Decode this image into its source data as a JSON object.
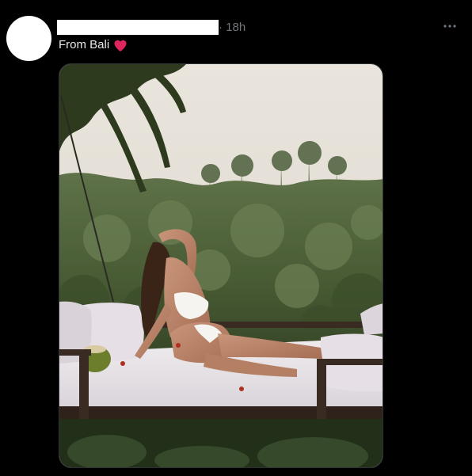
{
  "tweet": {
    "timestamp": "· 18h",
    "text": "From Bali",
    "emoji_icon": "heart-icon",
    "emoji_color": "#f91880",
    "more_icon": "more-horizontal-icon",
    "media": {
      "kind": "photo",
      "accessibility": ""
    }
  },
  "colors": {
    "background": "#000000",
    "text": "#e7e9ea",
    "muted": "#71767b",
    "border": "#2f3336"
  }
}
